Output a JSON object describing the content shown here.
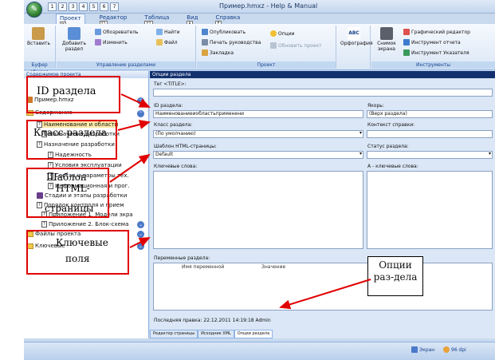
{
  "window": {
    "title": "Пример.hmxz - Help & Manual",
    "qat_keys": [
      "1",
      "2",
      "3",
      "4",
      "5",
      "6",
      "7"
    ],
    "tabs": [
      {
        "label": "Проект",
        "key": "H"
      },
      {
        "label": "Редактор",
        "key": "Y1"
      },
      {
        "label": "Таблица",
        "key": "Y2"
      },
      {
        "label": "Вид",
        "key": "A"
      },
      {
        "label": "Справка",
        "key": "E"
      }
    ]
  },
  "ribbon": {
    "clipboard": {
      "paste": "Вставить",
      "group": "Буфер обмена"
    },
    "sections": {
      "add": "Добавить раздел",
      "explorer": "Обозреватель",
      "edit": "Изменить",
      "find": "Найти",
      "file": "Файл",
      "group": "Управление разделами"
    },
    "project": {
      "publish": "Опубликовать",
      "print": "Печать руководства",
      "bookmark": "Закладка",
      "options": "Опции",
      "update": "Обновить проект",
      "group": "Проект"
    },
    "spell": "Орфография",
    "tools": {
      "snapshot": "Снимок экрана",
      "graphic": "Графический редактор",
      "report": "Инструмент отчета",
      "index": "Инструмент Указателя",
      "group": "Инструменты"
    }
  },
  "left_pane": {
    "header": "Содержимое проекта",
    "items": [
      "Пример.hmxz",
      "Содержание",
      "Наименование и области",
      "Назначение разработки",
      "Назначение разработки",
      "Надежность",
      "Условия эксплуатации",
      "Состав и параметры тех.",
      "Информационная и прог.",
      "Стадии и этапы разработки",
      "Порядок контроля и прием",
      "Приложение 1. Модели экра",
      "Приложение 2. Блок-схема",
      "Файлы проекта",
      "Ключевые"
    ]
  },
  "right_pane": {
    "header": "Опции раздела",
    "tag": "Тег <TITLE>:",
    "id_label": "ID раздела:",
    "id_value": "Наименованиеиобластьприменени",
    "anchor_label": "Якорь:",
    "anchor_value": "(Верх раздела)",
    "class_label": "Класс раздела:",
    "class_value": "(По умолчанию)",
    "context_label": "Контекст справки:",
    "template_label": "Шаблон HTML-страницы:",
    "template_value": "Default",
    "status_label": "Статус раздела:",
    "keywords_label": "Ключевые слова:",
    "akeywords_label": "A - ключевые слова:",
    "vars_label": "Переменные раздела:",
    "col_name": "Имя переменной",
    "col_value": "Значение",
    "last_edit": "Последняя правка: 22.12.2011 14:19:18 Admin"
  },
  "bottom_tabs": [
    "Редактор страницы",
    "Исходник XML",
    "Опции раздела"
  ],
  "status_bar": {
    "screen": "Экран",
    "dpi": "96 dpi"
  },
  "annotations": {
    "id": "ID раздела",
    "class": "Класс раздела",
    "template_line1": "Шаблон",
    "template_line2": "HTML-",
    "template_line3": "страницы",
    "keywords_line1": "Ключевые",
    "keywords_line2": "поля",
    "options": "Опции раз-дела"
  },
  "colors": {
    "annotation": "#e00000",
    "ribbon": "#dbe7f6",
    "header": "#12306e"
  }
}
